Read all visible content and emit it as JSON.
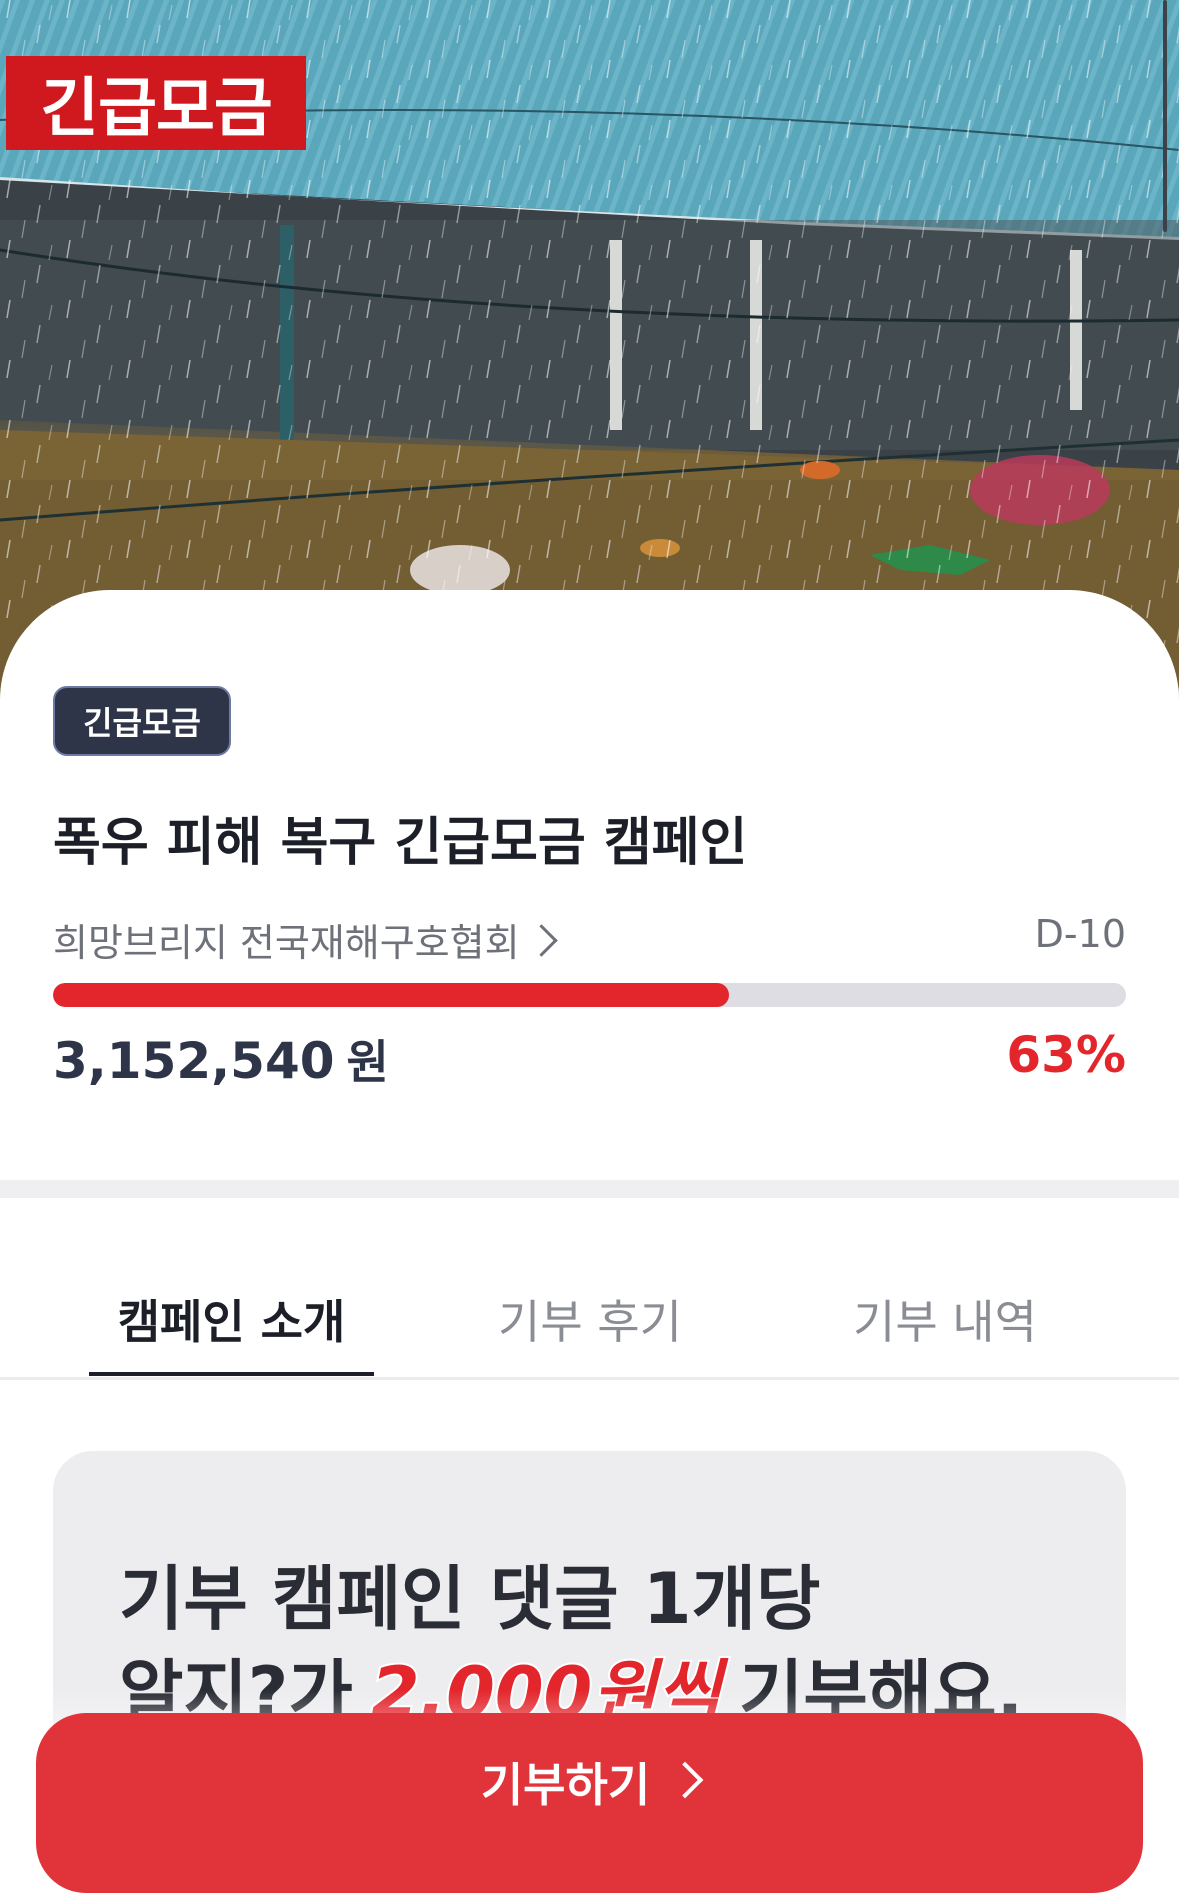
{
  "hero": {
    "tag_label": "긴급모금",
    "image_alt": "flooded-village-rain-photo"
  },
  "campaign": {
    "badge": "긴급모금",
    "title": "폭우 피해 복구 긴급모금 캠페인",
    "organization": "희망브리지 전국재해구호협회",
    "d_day": "D-10",
    "progress_percent": 63,
    "amount": "3,152,540",
    "amount_unit": "원",
    "percent_label": "63%"
  },
  "tabs": [
    {
      "label": "캠페인 소개",
      "active": true
    },
    {
      "label": "기부 후기",
      "active": false
    },
    {
      "label": "기부 내역",
      "active": false
    }
  ],
  "promo": {
    "line1": "기부 캠페인 댓글 1개당",
    "line2_prefix": "알지?가",
    "line2_highlight": "2,000원씩",
    "line2_suffix": "기부해요."
  },
  "donate_button": {
    "label": "기부하기"
  },
  "colors": {
    "accent_red": "#e3262c",
    "badge_navy": "#2e3548",
    "hero_tag_red": "#d0191f"
  }
}
